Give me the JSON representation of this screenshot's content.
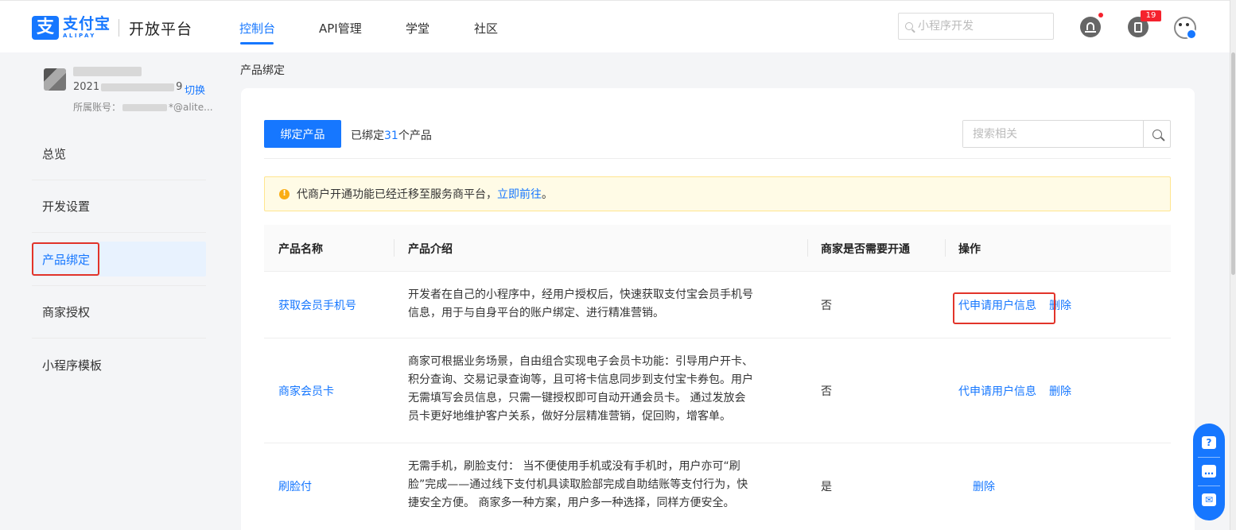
{
  "brand": {
    "logo_mark": "支",
    "name_cn": "支付宝",
    "name_en": "ALIPAY",
    "platform": "开放平台"
  },
  "nav": {
    "tabs": [
      {
        "label": "控制台",
        "active": true
      },
      {
        "label": "API管理"
      },
      {
        "label": "学堂"
      },
      {
        "label": "社区"
      }
    ],
    "search_placeholder": "小程序开发",
    "message_badge": "19"
  },
  "app": {
    "id_prefix": "2021",
    "id_suffix": "9",
    "switch_label": "切换",
    "account_label": "所属账号：",
    "account_suffix": "*@alite..."
  },
  "sidebar": {
    "items": [
      {
        "label": "总览"
      },
      {
        "label": "开发设置"
      },
      {
        "label": "产品绑定",
        "active": true
      },
      {
        "label": "商家授权"
      },
      {
        "label": "小程序模板"
      }
    ]
  },
  "page": {
    "breadcrumb": "产品绑定",
    "bind_button": "绑定产品",
    "bound_prefix": "已绑定",
    "bound_count": "31",
    "bound_suffix": "个产品",
    "search_placeholder": "搜索相关",
    "notice_text": "代商户开通功能已经迁移至服务商平台，",
    "notice_link": "立即前往",
    "notice_end": "。"
  },
  "table": {
    "headers": [
      "产品名称",
      "产品介绍",
      "商家是否需要开通",
      "操作"
    ],
    "rows": [
      {
        "name": "获取会员手机号",
        "desc_lines": [
          "开发者在自己的小程序中，经用户授权后，快速获取支付宝会员手机号",
          "信息，用于与自身平台的账户绑定、进行精准营销。"
        ],
        "need": "否",
        "op_apply": "代申请用户信息",
        "op_delete": "删除"
      },
      {
        "name": "商家会员卡",
        "desc_lines": [
          "商家可根据业务场景，自由组合实现电子会员卡功能：引导用户开卡、",
          "积分查询、交易记录查询等，且可将卡信息同步到支付宝卡券包。用户",
          "无需填写会员信息，只需一键授权即可自动开通会员卡。 通过发放会",
          "员卡更好地维护客户关系，做好分层精准营销，促回购，增客单。"
        ],
        "need": "否",
        "op_apply": "代申请用户信息",
        "op_delete": "删除"
      },
      {
        "name": "刷脸付",
        "desc_lines": [
          "无需手机，刷脸支付： 当不便使用手机或没有手机时，用户亦可“刷",
          "脸”完成——通过线下支付机具读取脸部完成自助结账等支付行为，快",
          "捷安全方便。 商家多一种方案，用户多一种选择，同样方便安全。"
        ],
        "need": "是",
        "op_delete": "删除"
      }
    ]
  },
  "float_panel": {
    "help_glyph": "?",
    "chat_glyph": "…",
    "feedback_glyph": "✉"
  },
  "colors": {
    "accent": "#1677ff",
    "highlight_border": "#e2342a",
    "warning": "#faad14"
  }
}
